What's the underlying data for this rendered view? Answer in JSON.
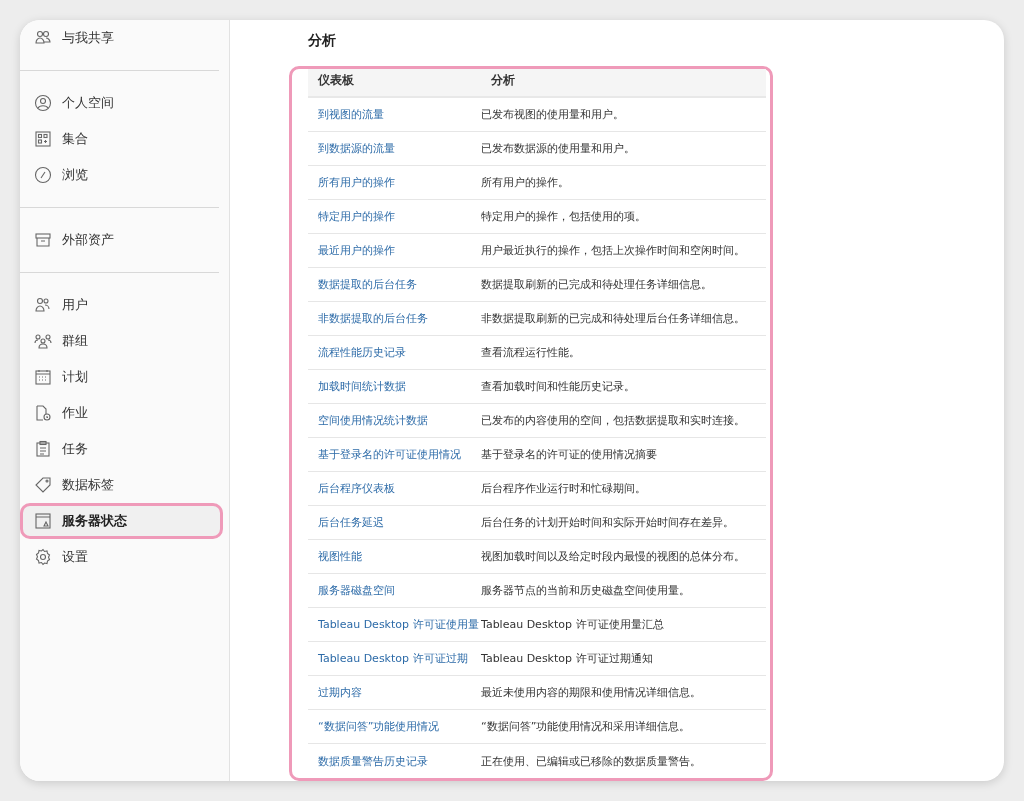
{
  "sidebar": {
    "sections": [
      {
        "items": [
          {
            "label": "与我共享",
            "selected": false
          }
        ]
      },
      {
        "items": [
          {
            "label": "个人空间",
            "selected": false
          },
          {
            "label": "集合",
            "selected": false
          },
          {
            "label": "浏览",
            "selected": false
          }
        ]
      },
      {
        "items": [
          {
            "label": "外部资产",
            "selected": false
          }
        ]
      },
      {
        "items": [
          {
            "label": "用户",
            "selected": false
          },
          {
            "label": "群组",
            "selected": false
          },
          {
            "label": "计划",
            "selected": false
          },
          {
            "label": "作业",
            "selected": false
          },
          {
            "label": "任务",
            "selected": false
          },
          {
            "label": "数据标签",
            "selected": false
          },
          {
            "label": "服务器状态",
            "selected": true
          },
          {
            "label": "设置",
            "selected": false
          }
        ]
      }
    ]
  },
  "content": {
    "title": "分析",
    "table": {
      "columns": [
        "仪表板",
        "分析"
      ],
      "rows": [
        {
          "dashboard": "到视图的流量",
          "description": "已发布视图的使用量和用户。"
        },
        {
          "dashboard": "到数据源的流量",
          "description": "已发布数据源的使用量和用户。"
        },
        {
          "dashboard": "所有用户的操作",
          "description": "所有用户的操作。"
        },
        {
          "dashboard": "特定用户的操作",
          "description": "特定用户的操作，包括使用的项。"
        },
        {
          "dashboard": "最近用户的操作",
          "description": "用户最近执行的操作，包括上次操作时间和空闲时间。"
        },
        {
          "dashboard": "数据提取的后台任务",
          "description": "数据提取刷新的已完成和待处理任务详细信息。"
        },
        {
          "dashboard": "非数据提取的后台任务",
          "description": "非数据提取刷新的已完成和待处理后台任务详细信息。"
        },
        {
          "dashboard": "流程性能历史记录",
          "description": "查看流程运行性能。"
        },
        {
          "dashboard": "加载时间统计数据",
          "description": "查看加载时间和性能历史记录。"
        },
        {
          "dashboard": "空间使用情况统计数据",
          "description": "已发布的内容使用的空间，包括数据提取和实时连接。"
        },
        {
          "dashboard": "基于登录名的许可证使用情况",
          "description": "基于登录名的许可证的使用情况摘要"
        },
        {
          "dashboard": "后台程序仪表板",
          "description": "后台程序作业运行时和忙碌期间。"
        },
        {
          "dashboard": "后台任务延迟",
          "description": "后台任务的计划开始时间和实际开始时间存在差异。"
        },
        {
          "dashboard": "视图性能",
          "description": "视图加载时间以及给定时段内最慢的视图的总体分布。"
        },
        {
          "dashboard": "服务器磁盘空间",
          "description": "服务器节点的当前和历史磁盘空间使用量。"
        },
        {
          "dashboard": "Tableau Desktop 许可证使用量",
          "description": "Tableau Desktop 许可证使用量汇总"
        },
        {
          "dashboard": "Tableau Desktop 许可证过期",
          "description": "Tableau Desktop 许可证过期通知"
        },
        {
          "dashboard": "过期内容",
          "description": "最近未使用内容的期限和使用情况详细信息。"
        },
        {
          "dashboard": "“数据问答”功能使用情况",
          "description": "“数据问答”功能使用情况和采用详细信息。"
        },
        {
          "dashboard": "数据质量警告历史记录",
          "description": "正在使用、已编辑或已移除的数据质量警告。"
        }
      ]
    }
  }
}
